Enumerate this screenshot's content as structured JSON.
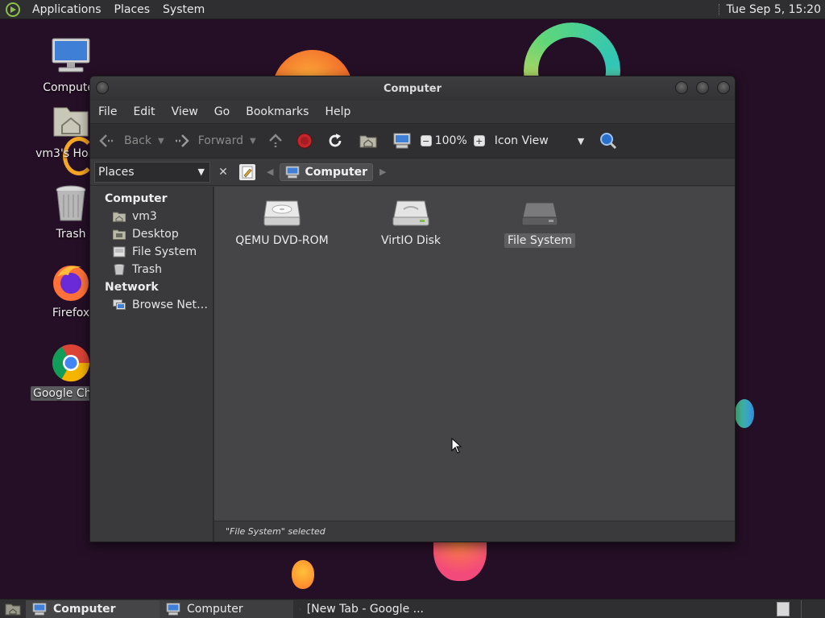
{
  "top_panel": {
    "menus": [
      "Applications",
      "Places",
      "System"
    ],
    "clock": "Tue Sep  5, 15:20"
  },
  "desktop_icons": [
    {
      "label": "Computer",
      "icon": "computer-icon",
      "selected": false
    },
    {
      "label": "vm3's Home",
      "icon": "home-folder-icon",
      "selected": false
    },
    {
      "label": "Trash",
      "icon": "trash-icon",
      "selected": false
    },
    {
      "label": "Firefox",
      "icon": "firefox-icon",
      "selected": false
    },
    {
      "label": "Google Chrome",
      "icon": "chrome-icon",
      "selected": true
    }
  ],
  "window": {
    "title": "Computer",
    "menubar": [
      "File",
      "Edit",
      "View",
      "Go",
      "Bookmarks",
      "Help"
    ],
    "toolbar": {
      "back": "Back",
      "forward": "Forward",
      "zoom": "100%",
      "view_mode": "Icon View"
    },
    "places_label": "Places",
    "breadcrumb": "Computer",
    "sidebar": {
      "computer_header": "Computer",
      "computer_items": [
        {
          "label": "vm3",
          "icon": "home-folder-icon"
        },
        {
          "label": "Desktop",
          "icon": "desktop-folder-icon"
        },
        {
          "label": "File System",
          "icon": "drive-icon"
        },
        {
          "label": "Trash",
          "icon": "trash-icon"
        }
      ],
      "network_header": "Network",
      "network_items": [
        {
          "label": "Browse Net…",
          "icon": "network-icon"
        }
      ]
    },
    "items": [
      {
        "label": "QEMU DVD-ROM",
        "icon": "optical-drive-icon",
        "selected": false
      },
      {
        "label": "VirtIO Disk",
        "icon": "hard-disk-icon",
        "selected": false
      },
      {
        "label": "File System",
        "icon": "filesystem-drive-icon",
        "selected": true
      }
    ],
    "status": "\"File System\" selected"
  },
  "taskbar": {
    "items": [
      {
        "label": "Computer",
        "icon": "computer-icon",
        "state": "active"
      },
      {
        "label": "Computer",
        "icon": "computer-icon",
        "state": "pressed"
      },
      {
        "label": "[New Tab - Google ...",
        "icon": "chrome-icon",
        "state": "normal"
      }
    ]
  },
  "colors": {
    "desktop_bg": "#250f26",
    "panel_bg": "#2f2f31",
    "window_bg": "#3b3b3d",
    "pane_bg": "#454547",
    "stop_red": "#c0262b"
  }
}
